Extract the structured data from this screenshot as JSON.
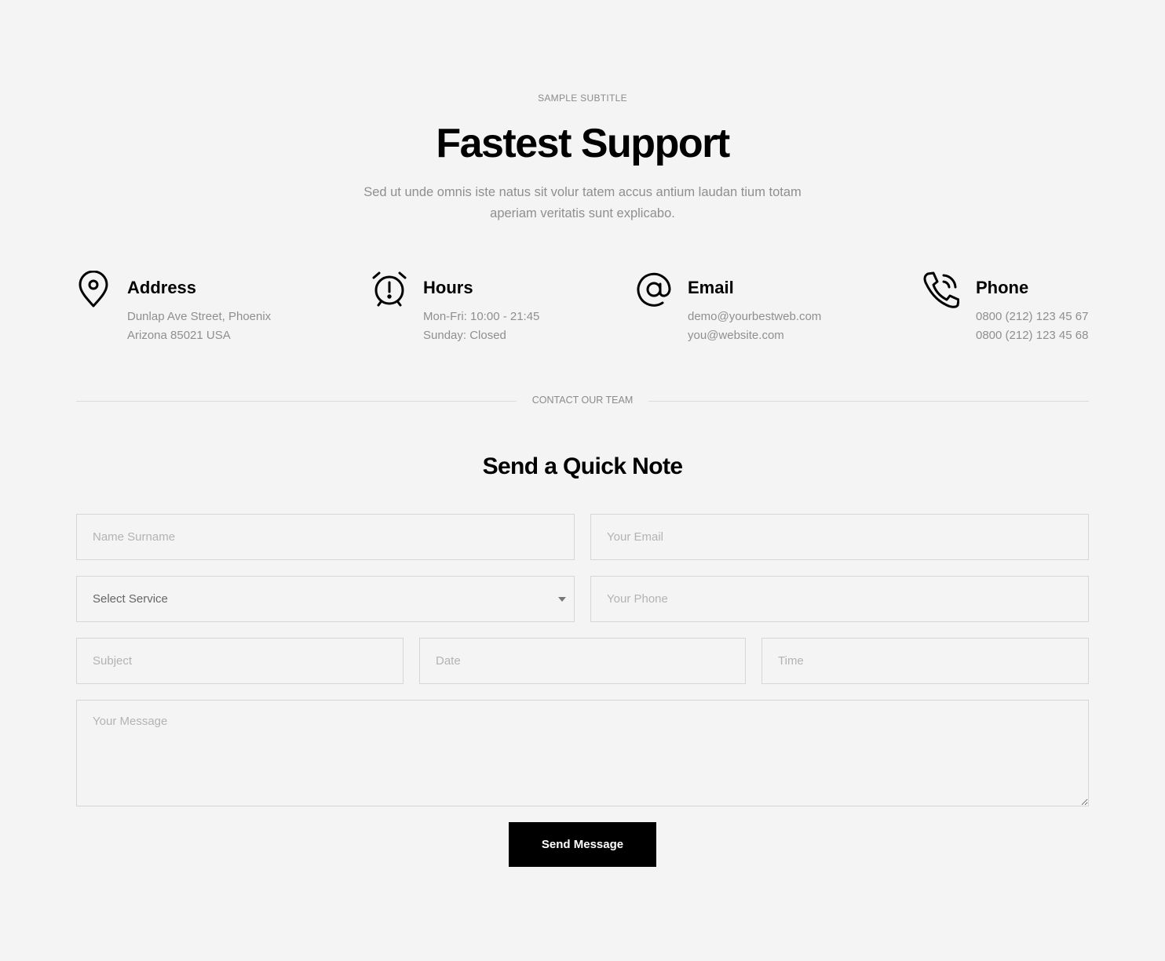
{
  "header": {
    "subtitle": "SAMPLE SUBTITLE",
    "title": "Fastest Support",
    "lead": "Sed ut unde omnis iste natus sit volur tatem accus antium laudan tium totam aperiam veritatis sunt explicabo."
  },
  "info": {
    "address": {
      "icon": "map-pin-icon",
      "heading": "Address",
      "line1": "Dunlap Ave Street, Phoenix",
      "line2": "Arizona 85021 USA"
    },
    "hours": {
      "icon": "alarm-clock-icon",
      "heading": "Hours",
      "line1": "Mon-Fri: 10:00 - 21:45",
      "line2": "Sunday: Closed"
    },
    "email": {
      "icon": "at-sign-icon",
      "heading": "Email",
      "line1": "demo@yourbestweb.com",
      "line2": "you@website.com"
    },
    "phone": {
      "icon": "phone-ringing-icon",
      "heading": "Phone",
      "line1": "0800 (212) 123 45 67",
      "line2": "0800 (212) 123 45 68"
    }
  },
  "divider": {
    "label": "CONTACT OUR TEAM"
  },
  "form": {
    "title": "Send a Quick Note",
    "name_placeholder": "Name Surname",
    "email_placeholder": "Your Email",
    "service_selected": "Select Service",
    "phone_placeholder": "Your Phone",
    "subject_placeholder": "Subject",
    "date_placeholder": "Date",
    "time_placeholder": "Time",
    "message_placeholder": "Your Message",
    "submit_label": "Send Message"
  },
  "colors": {
    "background": "#f4f4f4",
    "text": "#000000",
    "muted": "#8f8f8f",
    "border": "#d6d6d6",
    "button": "#000000"
  }
}
